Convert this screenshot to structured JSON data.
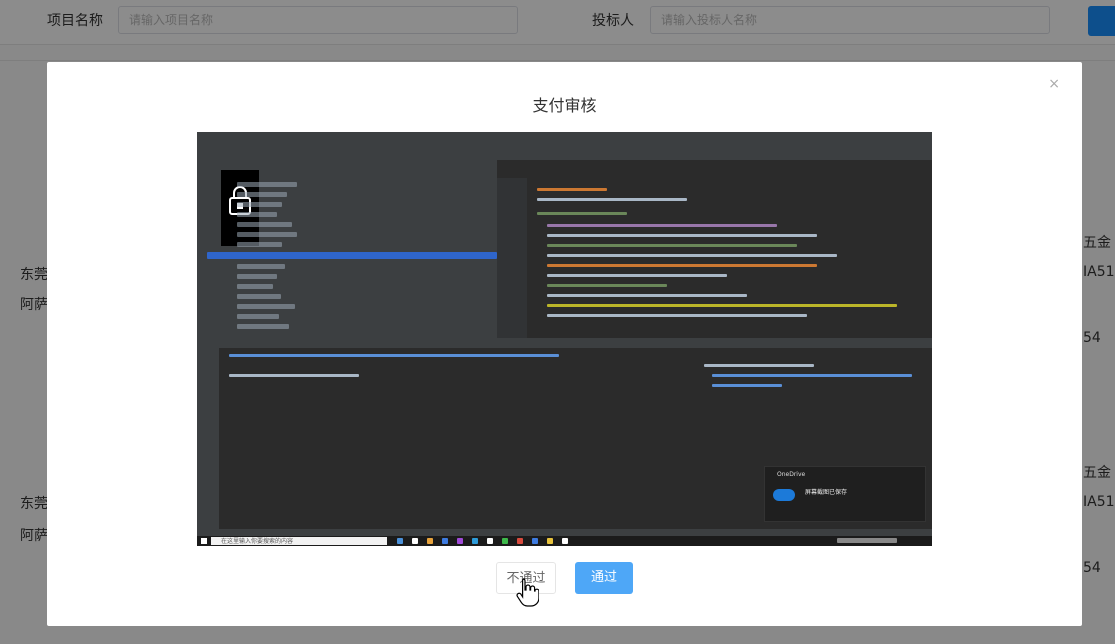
{
  "background": {
    "filter": {
      "project_name_label": "项目名称",
      "project_name_placeholder": "请输入项目名称",
      "bidder_label": "投标人",
      "bidder_placeholder": "请输入投标人名称"
    },
    "left_text": [
      "东莞",
      "阿萨",
      "东莞",
      "阿萨"
    ],
    "right_text": [
      "五金",
      "IA51",
      "54",
      "五金",
      "IA51",
      "54"
    ]
  },
  "modal": {
    "title": "支付审核",
    "close_glyph": "×",
    "reject_label": "不通过",
    "pass_label": "通过",
    "embedded_screenshot": {
      "taskbar_search_text": "在这里输入你要搜索的内容",
      "notification_app": "OneDrive",
      "notification_title": "屏幕截图已保存",
      "lock_icon": "lock-icon"
    }
  },
  "colors": {
    "primary": "#1890ff",
    "pass_button": "#4ea7f7",
    "overlay": "rgba(0,0,0,0.45)"
  }
}
